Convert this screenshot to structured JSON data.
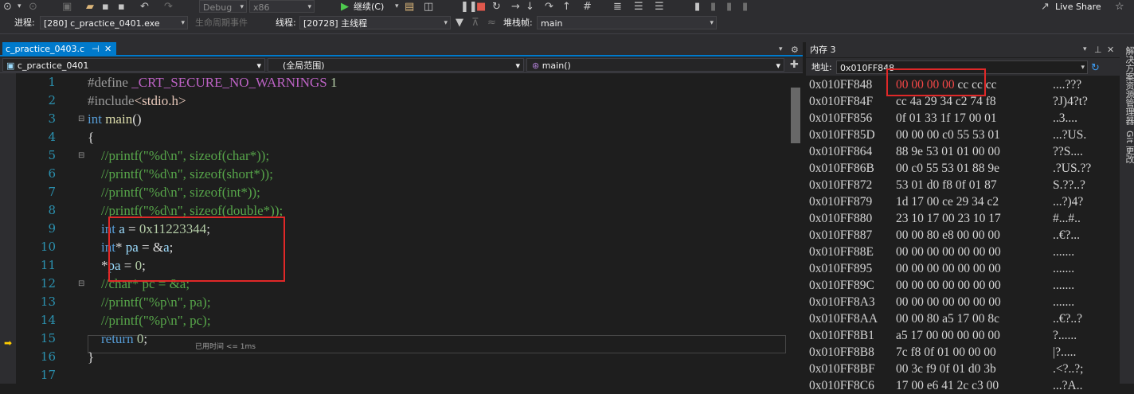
{
  "toolbar": {
    "config": "Debug",
    "platform": "x86",
    "continue": "继续(C)",
    "live_share": "Live Share"
  },
  "debugbar": {
    "process_label": "进程:",
    "process_value": "[280] c_practice_0401.exe",
    "lifecycle": "生命周期事件",
    "thread_label": "线程:",
    "thread_value": "[20728] 主线程",
    "stack_label": "堆栈帧:",
    "stack_value": "main"
  },
  "editor": {
    "tab": "c_practice_0403.c",
    "nav_project": "c_practice_0401",
    "nav_scope": "(全局范围)",
    "nav_function": "main()",
    "elapsed": "已用时间 <= 1ms",
    "line_numbers": [
      "1",
      "2",
      "3",
      "4",
      "5",
      "6",
      "7",
      "8",
      "9",
      "10",
      "11",
      "12",
      "13",
      "14",
      "15",
      "16",
      "17"
    ]
  },
  "memory": {
    "title": "内存 3",
    "address_label": "地址:",
    "address_value": "0x010FF848",
    "rows": [
      {
        "addr": "0x010FF848",
        "hex": "00 00 00 00 cc cc cc",
        "ascii": "....???"
      },
      {
        "addr": "0x010FF84F",
        "hex": "cc 4a 29 34 c2 74 f8",
        "ascii": "?J)4?t?"
      },
      {
        "addr": "0x010FF856",
        "hex": "0f 01 33 1f 17 00 01",
        "ascii": "..3...."
      },
      {
        "addr": "0x010FF85D",
        "hex": "00 00 00 c0 55 53 01",
        "ascii": "...?US."
      },
      {
        "addr": "0x010FF864",
        "hex": "88 9e 53 01 01 00 00",
        "ascii": "??S...."
      },
      {
        "addr": "0x010FF86B",
        "hex": "00 c0 55 53 01 88 9e",
        "ascii": ".?US.??"
      },
      {
        "addr": "0x010FF872",
        "hex": "53 01 d0 f8 0f 01 87",
        "ascii": "S.??..?"
      },
      {
        "addr": "0x010FF879",
        "hex": "1d 17 00 ce 29 34 c2",
        "ascii": "...?)4?"
      },
      {
        "addr": "0x010FF880",
        "hex": "23 10 17 00 23 10 17",
        "ascii": "#...#.."
      },
      {
        "addr": "0x010FF887",
        "hex": "00 00 80 e8 00 00 00",
        "ascii": "..€?..."
      },
      {
        "addr": "0x010FF88E",
        "hex": "00 00 00 00 00 00 00",
        "ascii": "......."
      },
      {
        "addr": "0x010FF895",
        "hex": "00 00 00 00 00 00 00",
        "ascii": "......."
      },
      {
        "addr": "0x010FF89C",
        "hex": "00 00 00 00 00 00 00",
        "ascii": "......."
      },
      {
        "addr": "0x010FF8A3",
        "hex": "00 00 00 00 00 00 00",
        "ascii": "......."
      },
      {
        "addr": "0x010FF8AA",
        "hex": "00 00 80 a5 17 00 8c",
        "ascii": "..€?..?"
      },
      {
        "addr": "0x010FF8B1",
        "hex": "a5 17 00 00 00 00 00",
        "ascii": "?......"
      },
      {
        "addr": "0x010FF8B8",
        "hex": "7c f8 0f 01 00 00 00",
        "ascii": "|?....."
      },
      {
        "addr": "0x010FF8BF",
        "hex": "00 3c f9 0f 01 d0 3b",
        "ascii": ".<?..?;"
      },
      {
        "addr": "0x010FF8C6",
        "hex": "17 00 e6 41 2c c3 00",
        "ascii": "...?A.."
      }
    ]
  },
  "side_tabs": [
    "解决方案资源管理器",
    "Git 更改"
  ]
}
